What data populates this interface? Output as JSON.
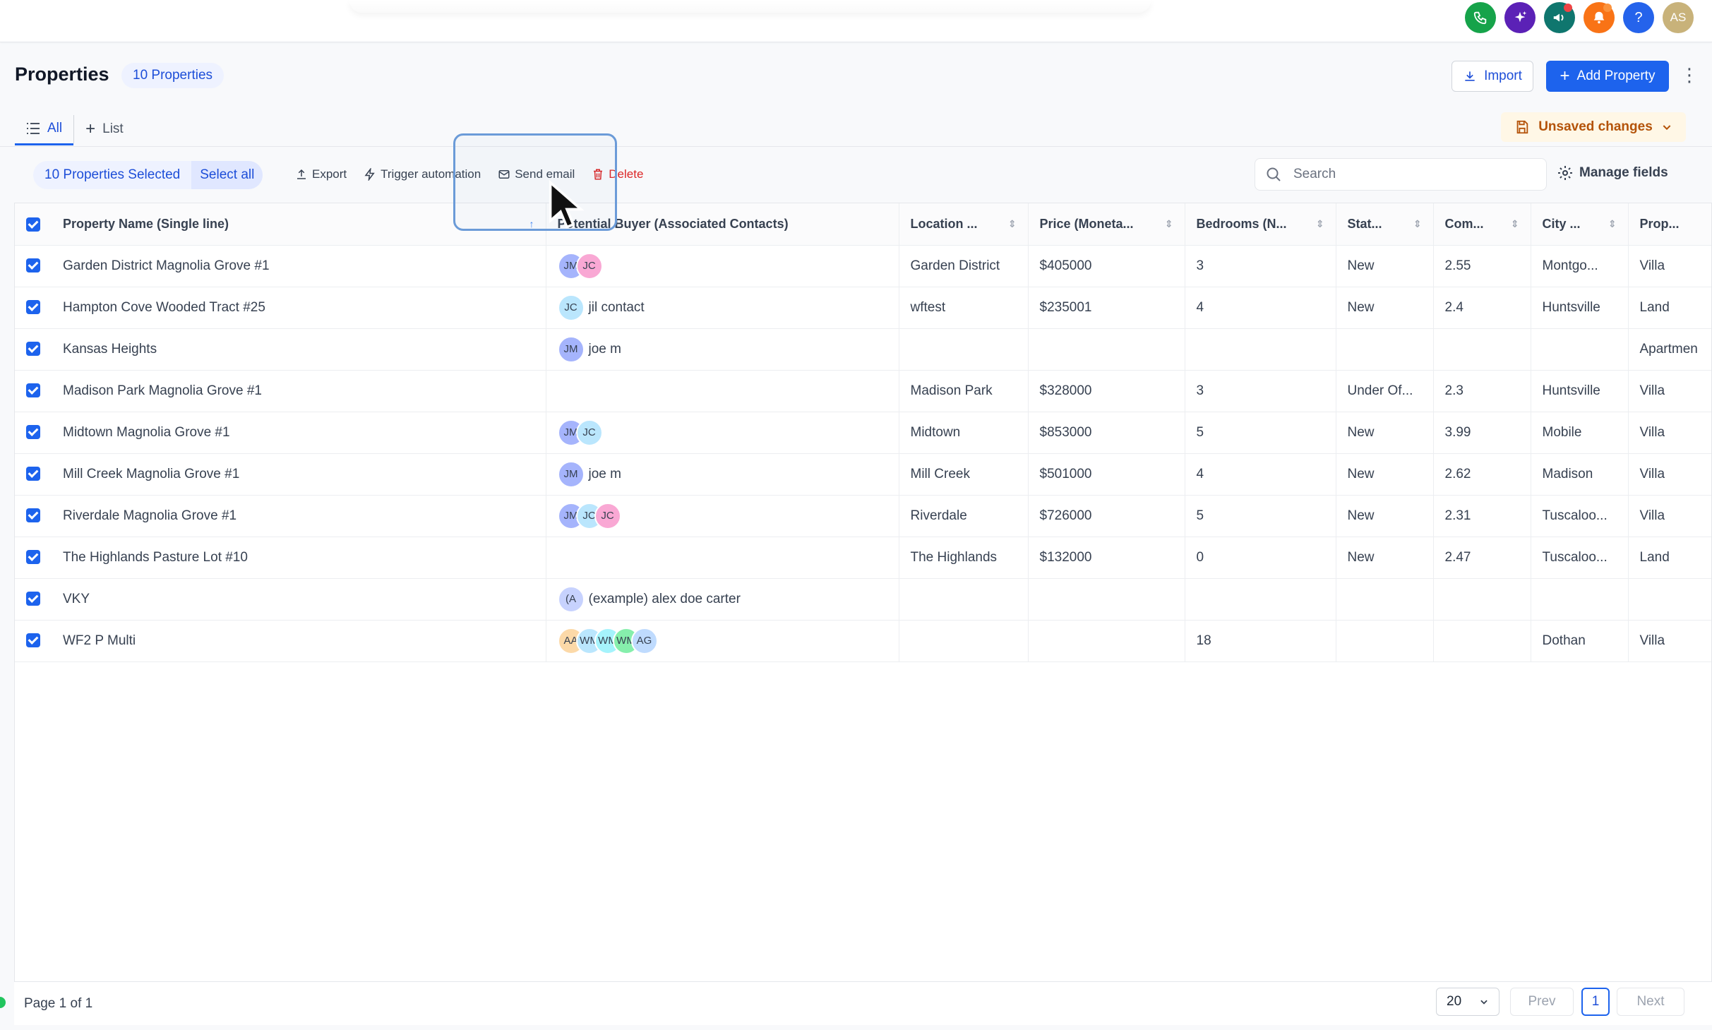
{
  "topbar": {
    "icons": [
      {
        "name": "phone-icon",
        "color": "#16a34a"
      },
      {
        "name": "sparkle-icon",
        "color": "#5b21b6"
      },
      {
        "name": "megaphone-icon",
        "color": "#0f766e",
        "badge": "#ef4444"
      },
      {
        "name": "bell-icon",
        "color": "#f97316",
        "badge": "#fb923c"
      },
      {
        "name": "help-icon",
        "color": "#2563eb",
        "glyph": "?"
      },
      {
        "name": "avatar",
        "color": "#c8b27a",
        "glyph": "AS"
      }
    ]
  },
  "header": {
    "title": "Properties",
    "count": "10 Properties",
    "import_label": "Import",
    "add_label": "Add Property"
  },
  "tabs": [
    {
      "label": "All",
      "active": true
    },
    {
      "label": "List",
      "active": false
    }
  ],
  "unsaved_label": "Unsaved changes",
  "selection": {
    "selected_label": "10 Properties Selected",
    "select_all_label": "Select all"
  },
  "actions": {
    "export": "Export",
    "trigger": "Trigger automation",
    "email": "Send email",
    "delete": "Delete"
  },
  "search": {
    "placeholder": "Search"
  },
  "manage_fields_label": "Manage fields",
  "table": {
    "columns": [
      "Property Name (Single line)",
      "Potential Buyer (Associated Contacts)",
      "Location ...",
      "Price (Moneta...",
      "Bedrooms (N...",
      "Stat...",
      "Com...",
      "City ...",
      "Prop..."
    ],
    "rows": [
      {
        "name": "Garden District Magnolia Grove #1",
        "buyers": [
          {
            "i": "JM",
            "c": "#a5b4fc"
          },
          {
            "i": "JC",
            "c": "#f9a8d4"
          }
        ],
        "buyer_label": "",
        "location": "Garden District",
        "price": "$405000",
        "bedrooms": "3",
        "status": "New",
        "com": "2.55",
        "city": "Montgo...",
        "prop": "Villa"
      },
      {
        "name": "Hampton Cove Wooded Tract #25",
        "buyers": [
          {
            "i": "JC",
            "c": "#bae6fd"
          }
        ],
        "buyer_label": "jil contact",
        "location": "wftest",
        "price": "$235001",
        "bedrooms": "4",
        "status": "New",
        "com": "2.4",
        "city": "Huntsville",
        "prop": "Land"
      },
      {
        "name": "Kansas Heights",
        "buyers": [
          {
            "i": "JM",
            "c": "#a5b4fc"
          }
        ],
        "buyer_label": "joe m",
        "location": "",
        "price": "",
        "bedrooms": "",
        "status": "",
        "com": "",
        "city": "",
        "prop": "Apartmen"
      },
      {
        "name": "Madison Park Magnolia Grove #1",
        "buyers": [],
        "buyer_label": "",
        "location": "Madison Park",
        "price": "$328000",
        "bedrooms": "3",
        "status": "Under Of...",
        "com": "2.3",
        "city": "Huntsville",
        "prop": "Villa"
      },
      {
        "name": "Midtown Magnolia Grove #1",
        "buyers": [
          {
            "i": "JM",
            "c": "#a5b4fc"
          },
          {
            "i": "JC",
            "c": "#bae6fd"
          }
        ],
        "buyer_label": "",
        "location": "Midtown",
        "price": "$853000",
        "bedrooms": "5",
        "status": "New",
        "com": "3.99",
        "city": "Mobile",
        "prop": "Villa"
      },
      {
        "name": "Mill Creek Magnolia Grove #1",
        "buyers": [
          {
            "i": "JM",
            "c": "#a5b4fc"
          }
        ],
        "buyer_label": "joe m",
        "location": "Mill Creek",
        "price": "$501000",
        "bedrooms": "4",
        "status": "New",
        "com": "2.62",
        "city": "Madison",
        "prop": "Villa"
      },
      {
        "name": "Riverdale Magnolia Grove #1",
        "buyers": [
          {
            "i": "JM",
            "c": "#a5b4fc"
          },
          {
            "i": "JC",
            "c": "#bae6fd"
          },
          {
            "i": "JC",
            "c": "#f9a8d4"
          }
        ],
        "buyer_label": "",
        "location": "Riverdale",
        "price": "$726000",
        "bedrooms": "5",
        "status": "New",
        "com": "2.31",
        "city": "Tuscaloo...",
        "prop": "Villa"
      },
      {
        "name": "The Highlands Pasture Lot #10",
        "buyers": [],
        "buyer_label": "",
        "location": "The Highlands",
        "price": "$132000",
        "bedrooms": "0",
        "status": "New",
        "com": "2.47",
        "city": "Tuscaloo...",
        "prop": "Land"
      },
      {
        "name": "VKY",
        "buyers": [
          {
            "i": "(A",
            "c": "#c7d2fe"
          }
        ],
        "buyer_label": "(example) alex doe carter",
        "location": "",
        "price": "",
        "bedrooms": "",
        "status": "",
        "com": "",
        "city": "",
        "prop": ""
      },
      {
        "name": "WF2 P Multi",
        "buyers": [
          {
            "i": "AA",
            "c": "#fcd9a8"
          },
          {
            "i": "WM",
            "c": "#bae6fd"
          },
          {
            "i": "WM",
            "c": "#a5f3fc"
          },
          {
            "i": "WM",
            "c": "#86efac"
          },
          {
            "i": "AG",
            "c": "#bfdbfe"
          }
        ],
        "buyer_label": "",
        "location": "",
        "price": "",
        "bedrooms": "18",
        "status": "",
        "com": "",
        "city": "Dothan",
        "prop": "Villa"
      }
    ]
  },
  "pagination": {
    "page_info": "Page 1 of 1",
    "per_page": "20",
    "prev": "Prev",
    "current": "1",
    "next": "Next"
  }
}
